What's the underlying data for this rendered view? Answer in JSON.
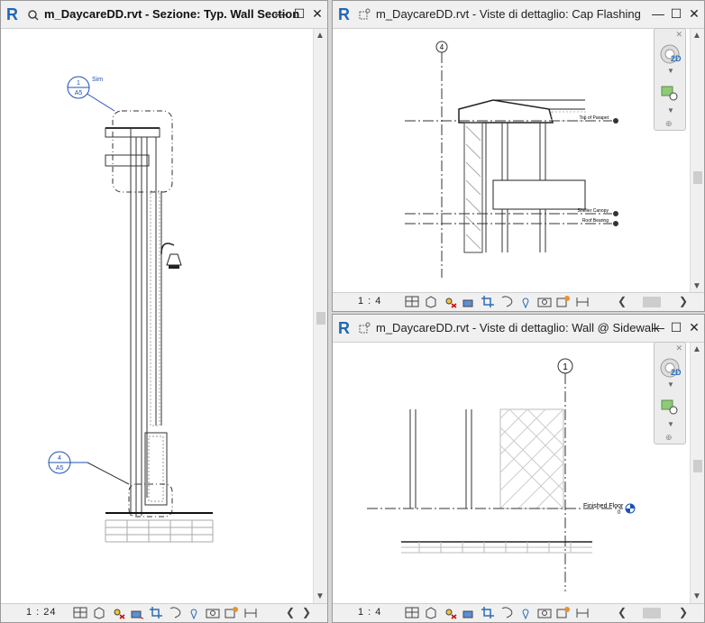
{
  "windows": [
    {
      "title": "m_DaycareDD.rvt - Sezione: Typ. Wall Section",
      "active": true,
      "scale": "1 : 24",
      "annotations": {
        "callout_top_num": "1",
        "callout_top_sheet": "A5",
        "callout_top_note": "Sim",
        "callout_bottom_num": "4",
        "callout_bottom_sheet": "A5"
      }
    },
    {
      "title": "m_DaycareDD.rvt - Viste di dettaglio: Cap Flashing",
      "active": false,
      "scale": "1 : 4",
      "annotations": {
        "grid_label": "4",
        "level1": "Top of Parapet",
        "level2": "Shelter Canopy",
        "level3": "Roof Bearing"
      }
    },
    {
      "title": "m_DaycareDD.rvt - Viste di dettaglio: Wall @ Sidewalk",
      "active": false,
      "scale": "1 : 4",
      "annotations": {
        "grid_label": "1",
        "level1": "Finished Floor",
        "level1_value": "0"
      }
    }
  ],
  "navbar": {
    "label_2d": "2D"
  },
  "colors": {
    "revit_blue": "#2166b3",
    "annotation_blue": "#1e50b4"
  },
  "icons": [
    "revit-logo-icon",
    "window-type-icon",
    "minimize-icon",
    "maximize-icon",
    "close-icon",
    "nav-wheel-icon",
    "zoom-region-icon",
    "scroll-up-icon",
    "scroll-down-icon",
    "visual-style-icon",
    "sun-path-icon",
    "crop-icon",
    "temp-hide-icon",
    "reveal-hidden-icon"
  ]
}
